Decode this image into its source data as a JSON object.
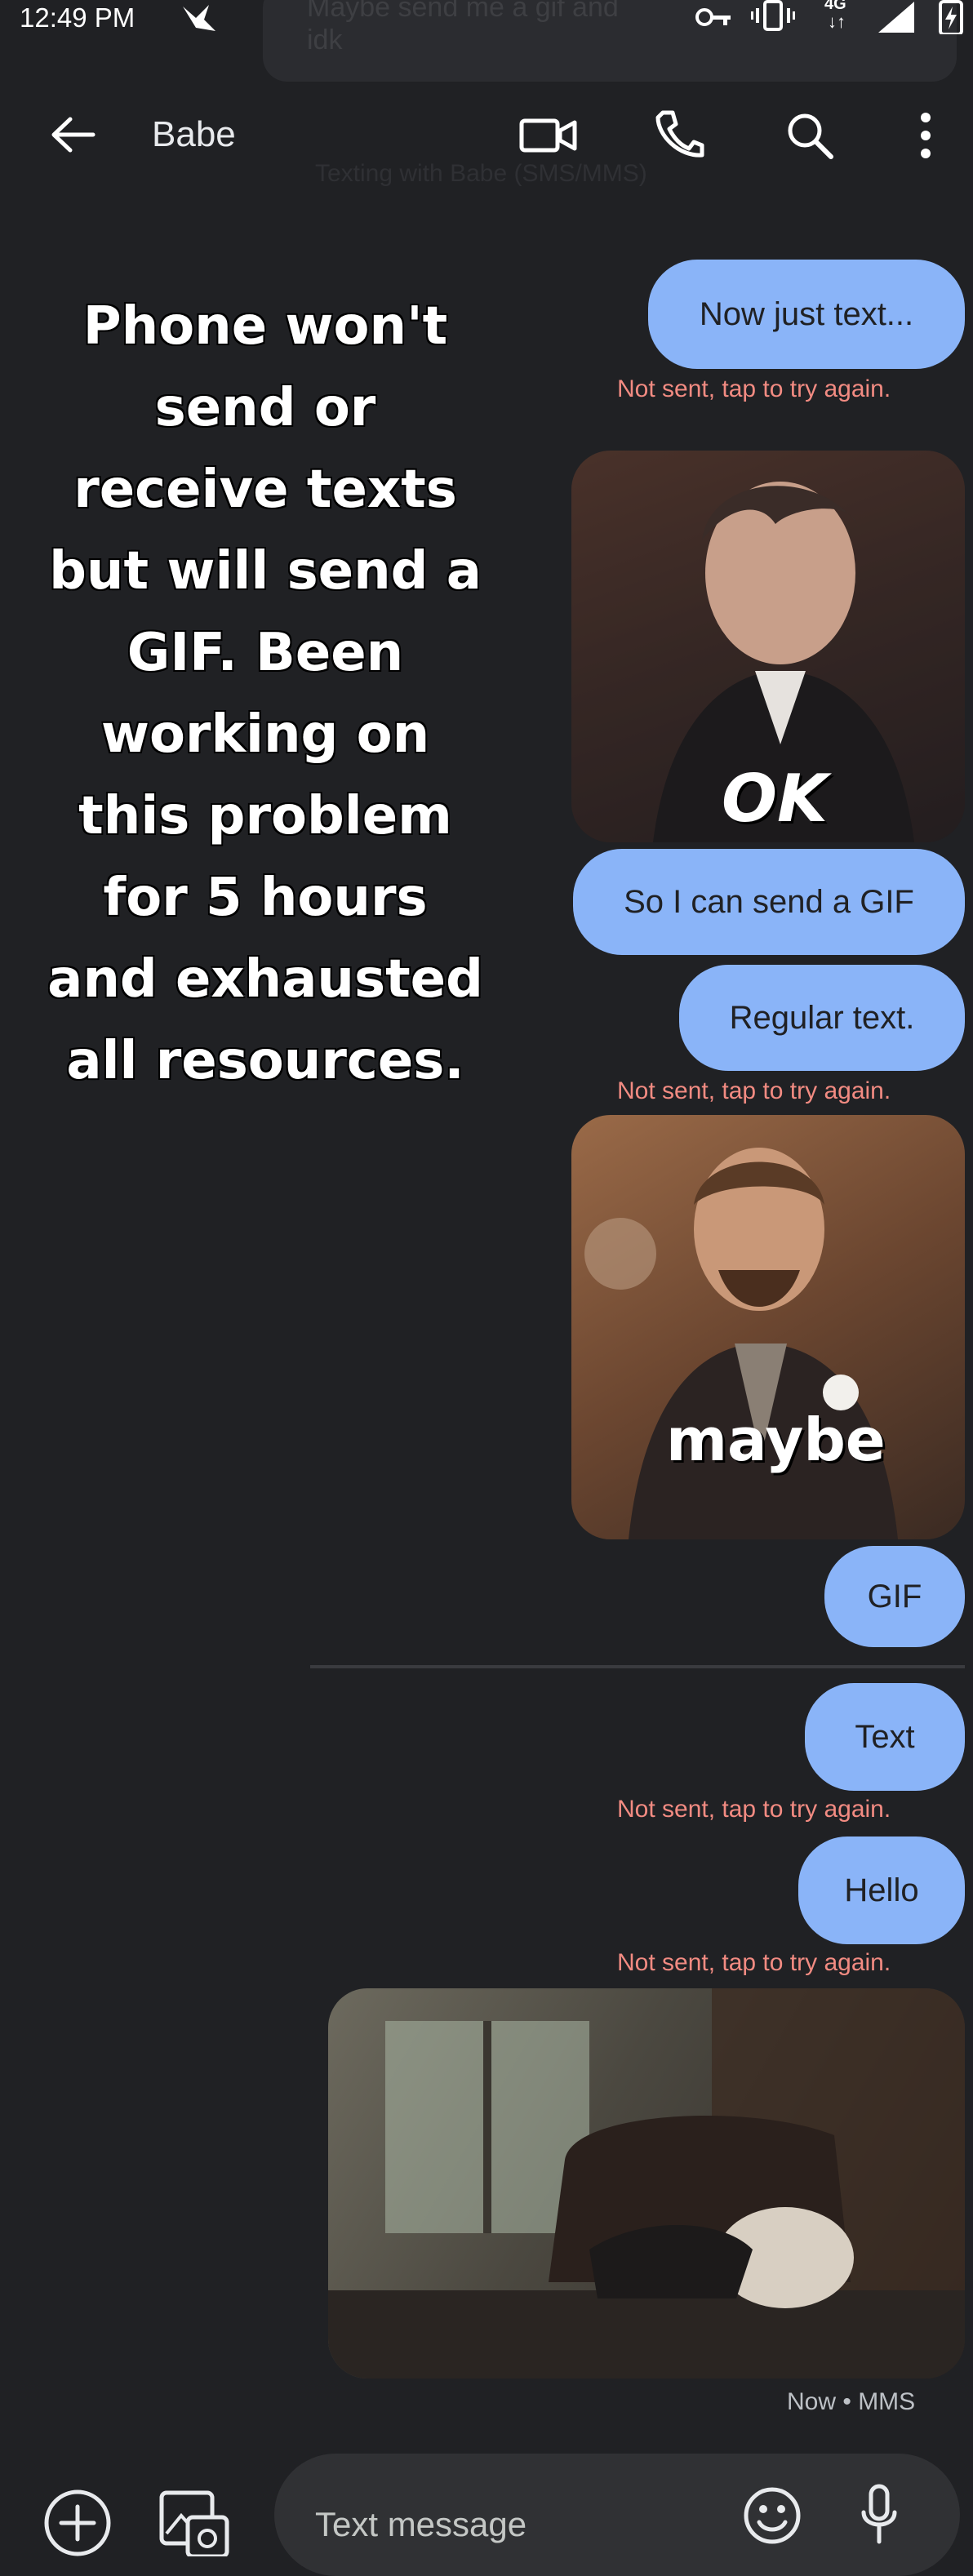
{
  "status_bar": {
    "time": "12:49 PM",
    "network": "4G"
  },
  "notification": {
    "line1": "Maybe send me a gif and",
    "line2": "idk"
  },
  "app_bar": {
    "contact_name": "Babe",
    "subtitle": "Texting with Babe (SMS/MMS)"
  },
  "caption": {
    "lines": [
      "Phone won't",
      "send or",
      "receive texts",
      "but will send a",
      "GIF. Been",
      "working on",
      "this problem",
      "for 5 hours",
      "and exhausted",
      "all resources."
    ]
  },
  "messages": {
    "m1_text": "Now just text...",
    "m1_status": "Not sent, tap to try again.",
    "gif1_label": "OK",
    "m2_text": "So I can send a GIF",
    "m3_text": "Regular text.",
    "m3_status": "Not sent, tap to try again.",
    "gif2_label": "maybe",
    "m4_text": "GIF",
    "m5_text": "Text",
    "m5_status": "Not sent, tap to try again.",
    "m6_text": "Hello",
    "m6_status": "Not sent, tap to try again.",
    "last_meta": "Now • MMS"
  },
  "compose": {
    "placeholder": "Text message"
  },
  "colors": {
    "background": "#202124",
    "bubble": "#8ab4f8",
    "error": "#f28b82"
  }
}
